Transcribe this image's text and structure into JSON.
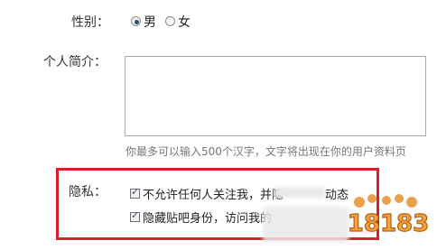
{
  "profile": {
    "gender_label": "性别：",
    "gender_options": [
      {
        "label": "男",
        "selected": true
      },
      {
        "label": "女",
        "selected": false
      }
    ],
    "bio_label": "个人简介：",
    "bio_value": "",
    "bio_hint": "你最多可以输入500个汉字，文字将出现在你的用户资料页"
  },
  "privacy": {
    "label": "隐私：",
    "options": [
      {
        "label": "不允许任何人关注我，并隐",
        "checked": true,
        "obscured_tail": "动态"
      },
      {
        "label": "隐藏贴吧身份，访问我的",
        "checked": true
      }
    ]
  },
  "watermark": {
    "text": "18183",
    "colors": {
      "primary": "#e8902a",
      "outline": "#b85c12"
    }
  },
  "colors": {
    "highlight_border": "#d9212c"
  }
}
